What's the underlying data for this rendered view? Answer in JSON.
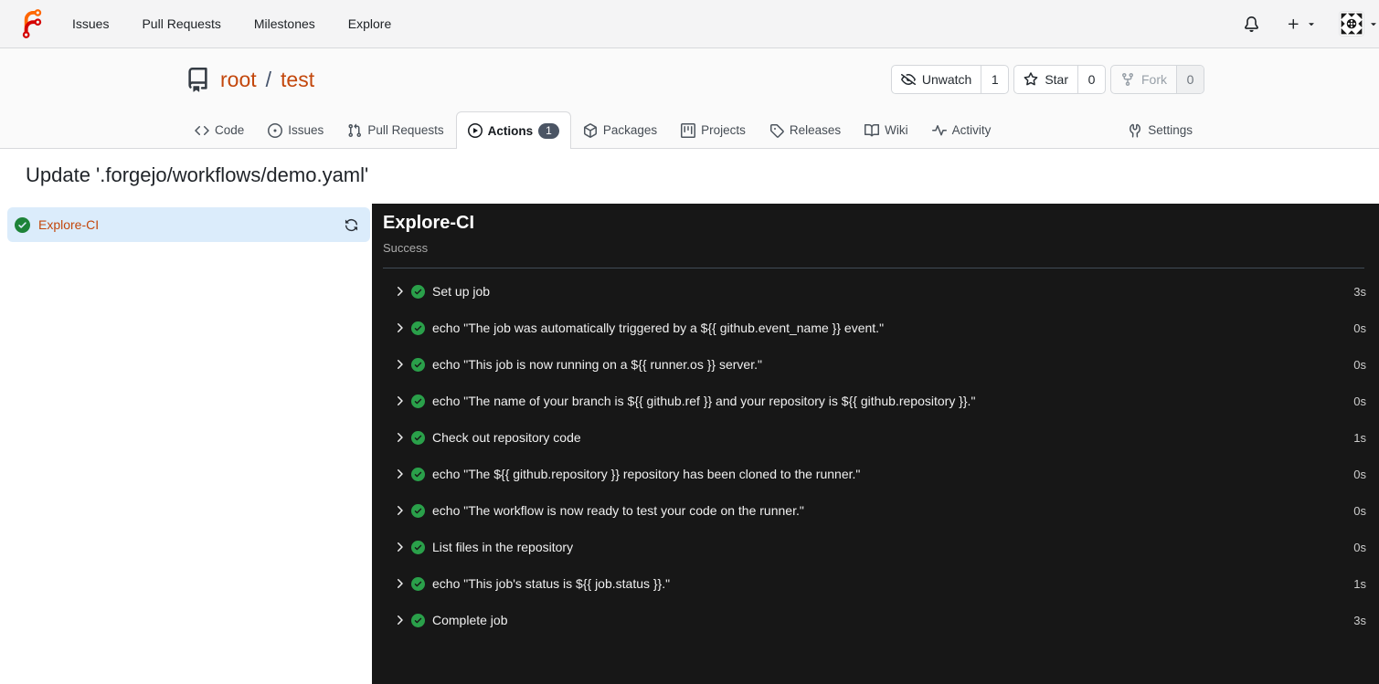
{
  "navbar": {
    "logo": "forgejo-logo",
    "links": [
      {
        "label": "Issues"
      },
      {
        "label": "Pull Requests"
      },
      {
        "label": "Milestones"
      },
      {
        "label": "Explore"
      }
    ],
    "right": {
      "notifications_icon": "bell",
      "create_icon": "plus",
      "avatar": "user-avatar"
    }
  },
  "repo_header": {
    "owner": "root",
    "separator": "/",
    "name": "test",
    "actions": [
      {
        "label": "Unwatch",
        "count": "1",
        "icon": "eye-closed",
        "disabled": false
      },
      {
        "label": "Star",
        "count": "0",
        "icon": "star",
        "disabled": false
      },
      {
        "label": "Fork",
        "count": "0",
        "icon": "repo-forked",
        "disabled": true
      }
    ],
    "tabs": [
      {
        "label": "Code",
        "icon": "code"
      },
      {
        "label": "Issues",
        "icon": "issue-opened"
      },
      {
        "label": "Pull Requests",
        "icon": "git-pull-request"
      },
      {
        "label": "Actions",
        "icon": "play",
        "active": true,
        "badge": "1"
      },
      {
        "label": "Packages",
        "icon": "package"
      },
      {
        "label": "Projects",
        "icon": "project"
      },
      {
        "label": "Releases",
        "icon": "tag"
      },
      {
        "label": "Wiki",
        "icon": "book"
      },
      {
        "label": "Activity",
        "icon": "pulse"
      },
      {
        "label": "Settings",
        "icon": "tools",
        "right": true
      }
    ]
  },
  "run": {
    "title": "Update '.forgejo/workflows/demo.yaml'",
    "jobs": [
      {
        "name": "Explore-CI",
        "status": "success",
        "status_icon": "check-circle-fill",
        "rerun_icon": "sync"
      }
    ],
    "job_header": {
      "name": "Explore-CI",
      "status_text": "Success"
    },
    "steps": [
      {
        "name": "Set up job",
        "duration": "3s"
      },
      {
        "name": "echo \"The job was automatically triggered by a ${{ github.event_name }} event.\"",
        "duration": "0s"
      },
      {
        "name": "echo \"This job is now running on a ${{ runner.os }} server.\"",
        "duration": "0s"
      },
      {
        "name": "echo \"The name of your branch is ${{ github.ref }} and your repository is ${{ github.repository }}.\"",
        "duration": "0s"
      },
      {
        "name": "Check out repository code",
        "duration": "1s"
      },
      {
        "name": "echo \"The ${{ github.repository }} repository has been cloned to the runner.\"",
        "duration": "0s"
      },
      {
        "name": "echo \"The workflow is now ready to test your code on the runner.\"",
        "duration": "0s"
      },
      {
        "name": "List files in the repository",
        "duration": "0s"
      },
      {
        "name": "echo \"This job's status is ${{ job.status }}.\"",
        "duration": "1s"
      },
      {
        "name": "Complete job",
        "duration": "3s"
      }
    ]
  },
  "colors": {
    "primary": "#c3470c",
    "nav_bg": "#f4f4f5",
    "header_bg": "#fafafa",
    "console_bg": "#171717",
    "job_selected_bg": "#dbecfb",
    "success_green_light": "#1d8338",
    "success_green_dark": "#2aa04a",
    "badge_bg": "#4b5564",
    "logo_orange": "#ff6600",
    "logo_red": "#d40000"
  }
}
